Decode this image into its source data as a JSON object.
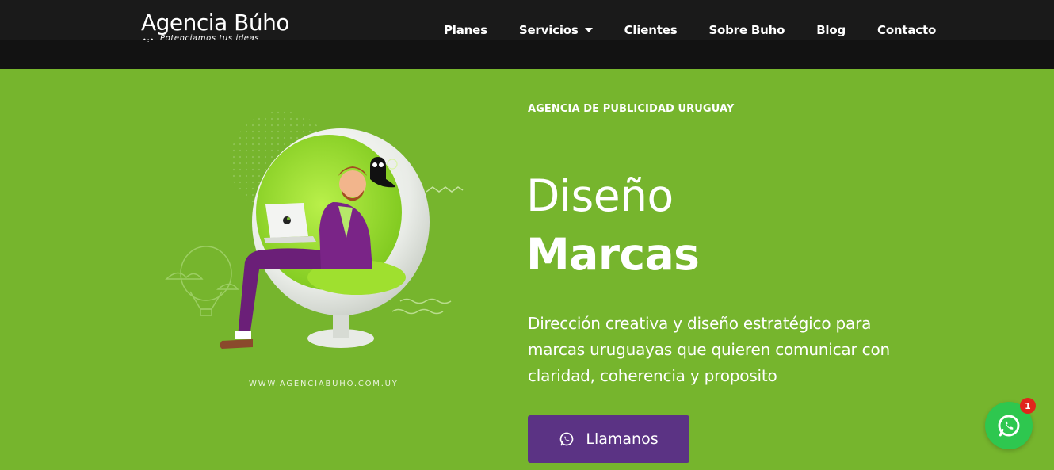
{
  "header": {
    "logo_title": "Agencia Búho",
    "logo_tagline": "Potenciamos tus ideas",
    "nav": [
      {
        "label": "Planes"
      },
      {
        "label": "Servicios",
        "has_dropdown": true
      },
      {
        "label": "Clientes"
      },
      {
        "label": "Sobre Buho"
      },
      {
        "label": "Blog"
      },
      {
        "label": "Contacto"
      }
    ]
  },
  "hero": {
    "eyebrow": "AGENCIA DE PUBLICIDAD URUGUAY",
    "title_line1": "Diseño",
    "title_line2": "Marcas",
    "description": "Dirección creativa y diseño estratégico para marcas uruguayas que quieren comunicar con claridad, coherencia y proposito",
    "cta_label": "Llamanos",
    "cta_icon": "whatsapp-icon",
    "illustration_url_text": "WWW.AGENCIABUHO.COM.UY"
  },
  "floating_whatsapp": {
    "icon": "whatsapp-icon",
    "badge_count": "1"
  },
  "colors": {
    "header_bg": "#121212",
    "hero_bg": "#76b52d",
    "cta_bg": "#5b3384",
    "whatsapp_green": "#2ec74f",
    "badge_red": "#e0261c"
  }
}
